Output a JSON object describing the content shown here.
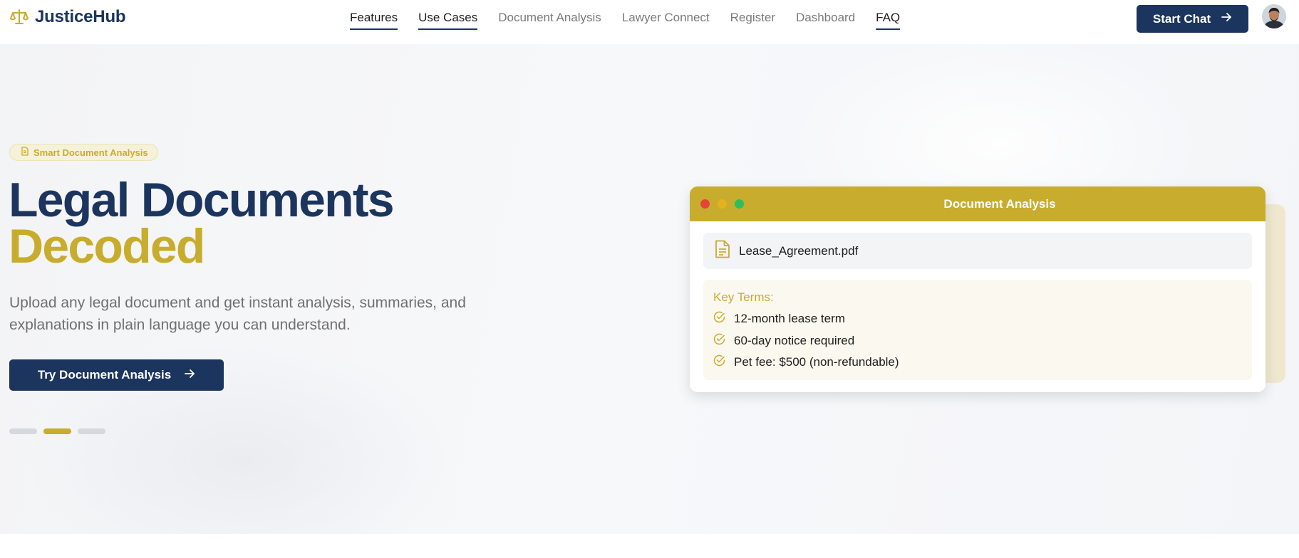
{
  "brand": {
    "name": "JusticeHub",
    "icon": "scales-icon"
  },
  "nav": {
    "links": [
      {
        "label": "Features",
        "active": true
      },
      {
        "label": "Use Cases",
        "active": true
      },
      {
        "label": "Document Analysis",
        "active": false
      },
      {
        "label": "Lawyer Connect",
        "active": false
      },
      {
        "label": "Register",
        "active": false
      },
      {
        "label": "Dashboard",
        "active": false
      },
      {
        "label": "FAQ",
        "active": true
      }
    ],
    "start_chat_label": "Start Chat",
    "avatar_icon": "user-avatar"
  },
  "hero": {
    "badge": "Smart Document Analysis",
    "title_line1": "Legal Documents",
    "title_line2": "Decoded",
    "subtitle": "Upload any legal document and get instant analysis, summaries, and explanations in plain language you can understand.",
    "cta_label": "Try Document Analysis",
    "carousel": {
      "count": 3,
      "active_index": 1
    }
  },
  "preview_card": {
    "title": "Document Analysis",
    "file_name": "Lease_Agreement.pdf",
    "key_terms_title": "Key Terms:",
    "key_terms": [
      "12-month lease term",
      "60-day notice required",
      "Pet fee: $500 (non-refundable)"
    ]
  },
  "colors": {
    "navy": "#1c355e",
    "gold": "#c8ac2e",
    "window_red": "#e5423a",
    "window_yellow": "#e4b21c",
    "window_green": "#2cbf5a"
  }
}
